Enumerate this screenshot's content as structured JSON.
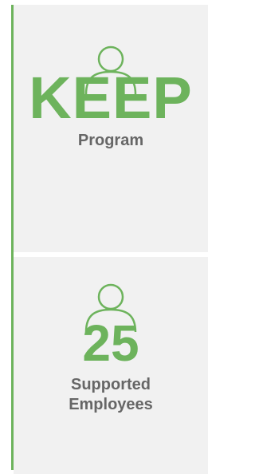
{
  "accent_color": "#6db35c",
  "caption_color": "#666666",
  "cards": [
    {
      "icon": "person-icon",
      "value": "KEEP",
      "caption_lines": [
        "Program"
      ]
    },
    {
      "icon": "person-icon",
      "value": "25",
      "caption_lines": [
        "Supported",
        "Employees"
      ]
    }
  ]
}
